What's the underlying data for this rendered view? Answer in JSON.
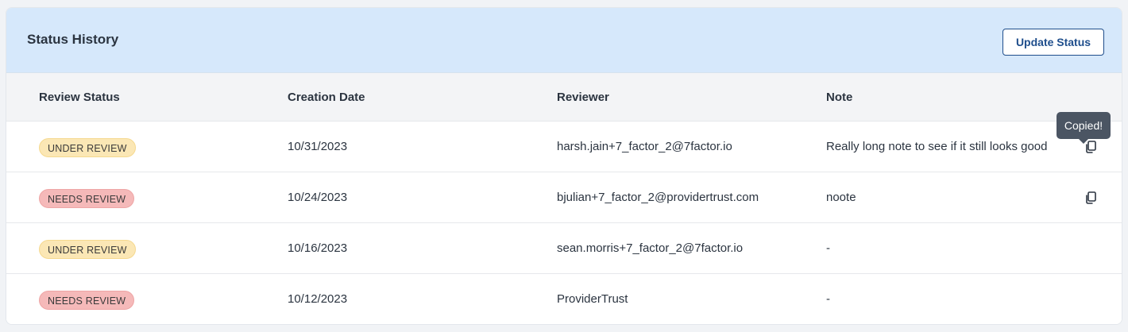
{
  "panel": {
    "title": "Status History",
    "update_button_label": "Update Status"
  },
  "table": {
    "columns": [
      "Review Status",
      "Creation Date",
      "Reviewer",
      "Note"
    ],
    "rows": [
      {
        "status": "UNDER REVIEW",
        "status_type": "under",
        "date": "10/31/2023",
        "reviewer": "harsh.jain+7_factor_2@7factor.io",
        "note": "Really long note to see if it still looks good",
        "copyable": true
      },
      {
        "status": "NEEDS REVIEW",
        "status_type": "needs",
        "date": "10/24/2023",
        "reviewer": "bjulian+7_factor_2@providertrust.com",
        "note": "noote",
        "copyable": true
      },
      {
        "status": "UNDER REVIEW",
        "status_type": "under",
        "date": "10/16/2023",
        "reviewer": "sean.morris+7_factor_2@7factor.io",
        "note": "-",
        "copyable": false
      },
      {
        "status": "NEEDS REVIEW",
        "status_type": "needs",
        "date": "10/12/2023",
        "reviewer": "ProviderTrust",
        "note": "-",
        "copyable": false
      }
    ]
  },
  "tooltip": {
    "text": "Copied!"
  },
  "colors": {
    "header_bg": "#d6e8fb",
    "accent": "#1f4e8c",
    "under_review_badge": "#fbe7b5",
    "needs_review_badge": "#f5b9b9",
    "tooltip_bg": "#4b5563"
  },
  "icons": {
    "copy": "copy-icon"
  }
}
